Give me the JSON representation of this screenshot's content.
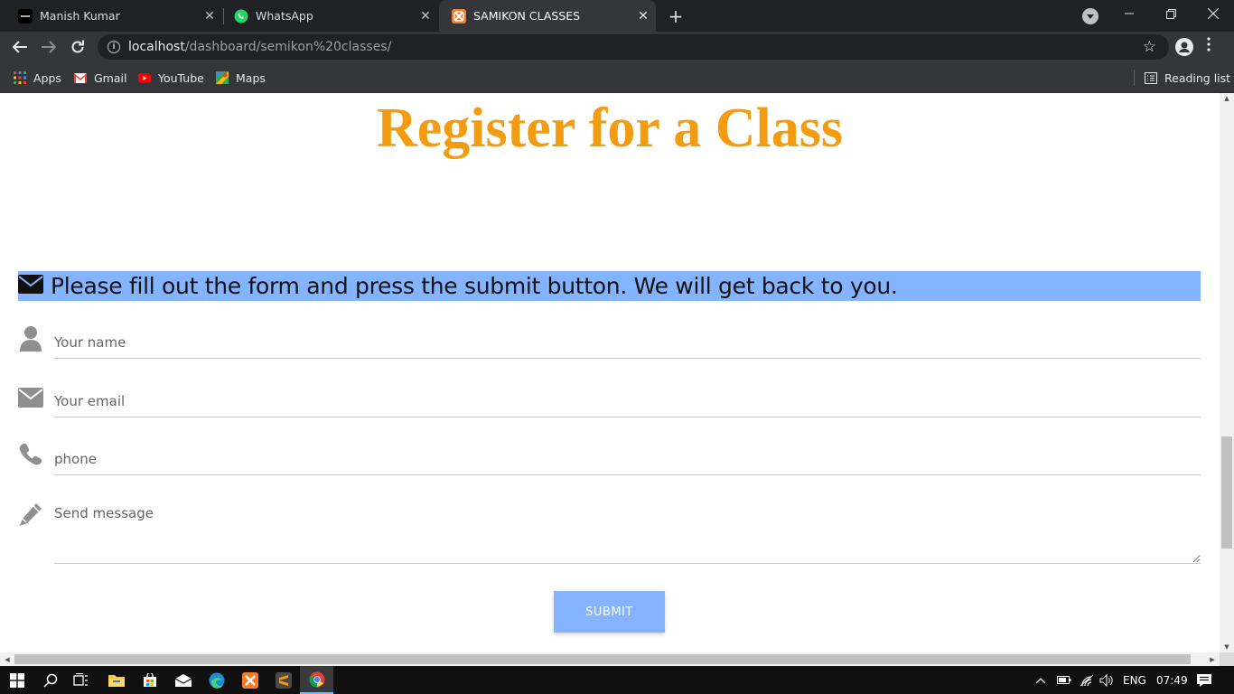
{
  "browser": {
    "tabs": [
      {
        "title": "Manish Kumar",
        "icon": "page-icon"
      },
      {
        "title": "WhatsApp",
        "icon": "whatsapp-icon"
      },
      {
        "title": "SAMIKON CLASSES",
        "icon": "xampp-icon",
        "active": true
      }
    ],
    "url_host": "localhost",
    "url_path": "/dashboard/semikon%20classes/",
    "bookmarks": [
      {
        "label": "Apps",
        "icon": "apps-grid-icon"
      },
      {
        "label": "Gmail",
        "icon": "gmail-icon"
      },
      {
        "label": "YouTube",
        "icon": "youtube-icon"
      },
      {
        "label": "Maps",
        "icon": "maps-icon"
      }
    ],
    "reading_list": "Reading list"
  },
  "page": {
    "title": "Register for a Class",
    "banner": "Please fill out the form and press the submit button. We will get back to you.",
    "form": {
      "name_placeholder": "Your name",
      "email_placeholder": "Your email",
      "phone_placeholder": "phone",
      "message_placeholder": "Send message",
      "submit_label": "SUBMIT"
    }
  },
  "taskbar": {
    "language": "ENG",
    "time": "07:49"
  },
  "colors": {
    "title": "#f39c12",
    "banner_bg": "#84b4ff",
    "submit_bg": "#84b4ff",
    "icon_gray": "#8f8f8f"
  }
}
